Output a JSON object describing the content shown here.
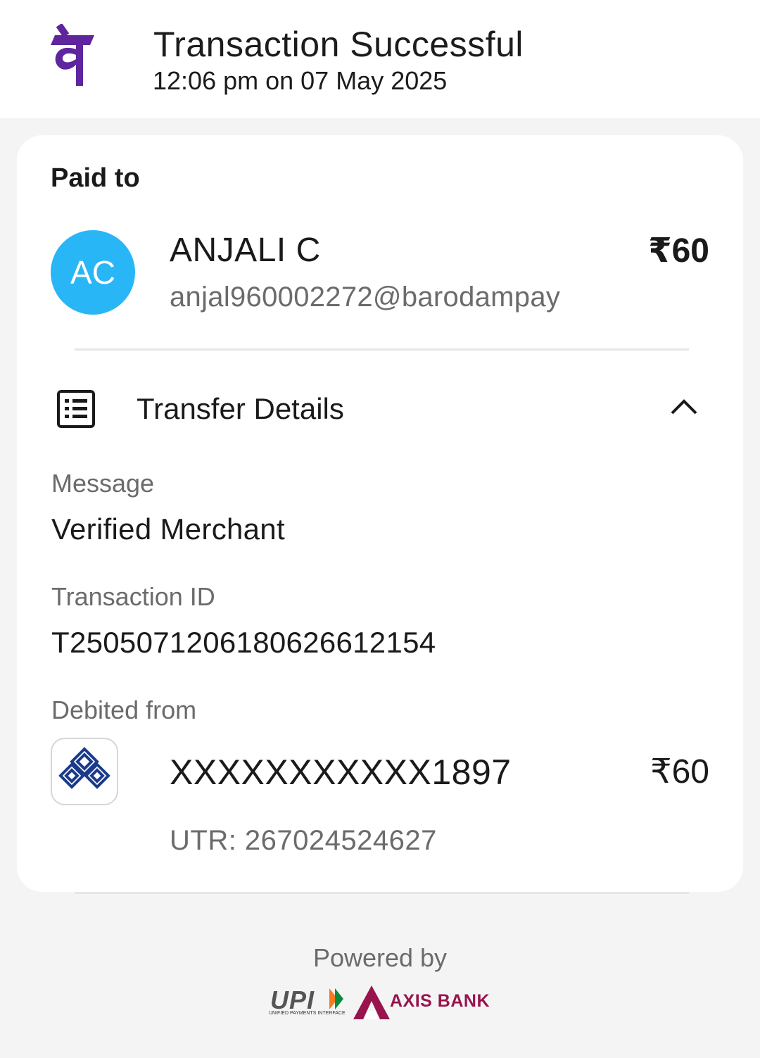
{
  "header": {
    "title": "Transaction Successful",
    "subtitle": "12:06 pm on 07 May 2025",
    "logo_icon": "phonepe-logo-icon",
    "logo_color": "#5f259f"
  },
  "payee": {
    "section_label": "Paid to",
    "avatar_initials": "AC",
    "avatar_color": "#29b6f6",
    "name": "ANJALI C",
    "upi_id": "anjal960002272@barodampay",
    "amount": "₹60"
  },
  "transfer_details": {
    "title": "Transfer Details",
    "icon": "receipt-list-icon",
    "toggle_icon": "chevron-up-icon",
    "message_label": "Message",
    "message_value": "Verified Merchant",
    "txn_label": "Transaction ID",
    "txn_value": "T2505071206180626612154",
    "debited_label": "Debited from",
    "bank_icon": "bank-of-india-logo-icon",
    "account_number": "XXXXXXXXXXX1897",
    "account_amount": "₹60",
    "utr": "UTR: 267024524627"
  },
  "footer": {
    "powered_by": "Powered by",
    "upi_logo_text": "UPI",
    "upi_logo_sub": "UNIFIED PAYMENTS INTERFACE",
    "bank_partner": "AXIS BANK",
    "axis_color": "#97144d"
  }
}
